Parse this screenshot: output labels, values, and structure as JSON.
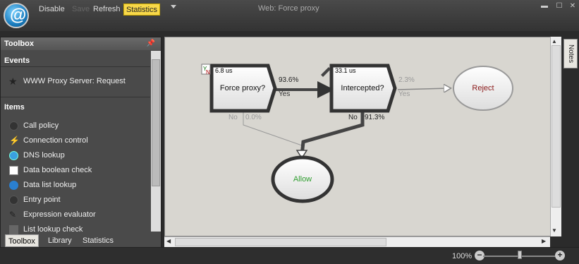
{
  "toolbar": {
    "disable_label": "Disable",
    "save_label": "Save",
    "refresh_label": "Refresh",
    "statistics_label": "Statistics"
  },
  "window": {
    "title": "Web: Force proxy"
  },
  "toolbox": {
    "title": "Toolbox",
    "events_heading": "Events",
    "events": [
      {
        "label": "WWW Proxy Server: Request",
        "icon": "star-icon"
      }
    ],
    "items_heading": "Items",
    "items": [
      {
        "label": "Call policy",
        "icon": "circle-icon"
      },
      {
        "label": "Connection control",
        "icon": "plug-icon"
      },
      {
        "label": "DNS lookup",
        "icon": "dns-icon"
      },
      {
        "label": "Data boolean check",
        "icon": "yes-no-icon"
      },
      {
        "label": "Data list lookup",
        "icon": "globe-icon"
      },
      {
        "label": "Entry point",
        "icon": "circle-icon"
      },
      {
        "label": "Expression evaluator",
        "icon": "pen-icon"
      },
      {
        "label": "List lookup check",
        "icon": "list-icon"
      }
    ],
    "tabs": [
      "Toolbox",
      "Library",
      "Statistics"
    ]
  },
  "notes_label": "Notes",
  "flow": {
    "node1": {
      "time": "6.8 us",
      "label": "Force proxy?"
    },
    "node2": {
      "time": "33.1 us",
      "label": "Intercepted?"
    },
    "reject": {
      "label": "Reject"
    },
    "allow": {
      "label": "Allow"
    },
    "edge1": {
      "pct": "93.6%",
      "branch": "Yes"
    },
    "edge2": {
      "pct": "2.3%",
      "branch": "Yes"
    },
    "edge3": {
      "pct": "0.0%",
      "branch": "No"
    },
    "edge4": {
      "pct": "91.3%",
      "branch": "No"
    }
  },
  "zoom": {
    "label": "100%",
    "level": 1.0
  },
  "colors": {
    "active_button": "#f8d84a",
    "reject_text": "#8b1a1a",
    "allow_text": "#2f9e2f"
  }
}
